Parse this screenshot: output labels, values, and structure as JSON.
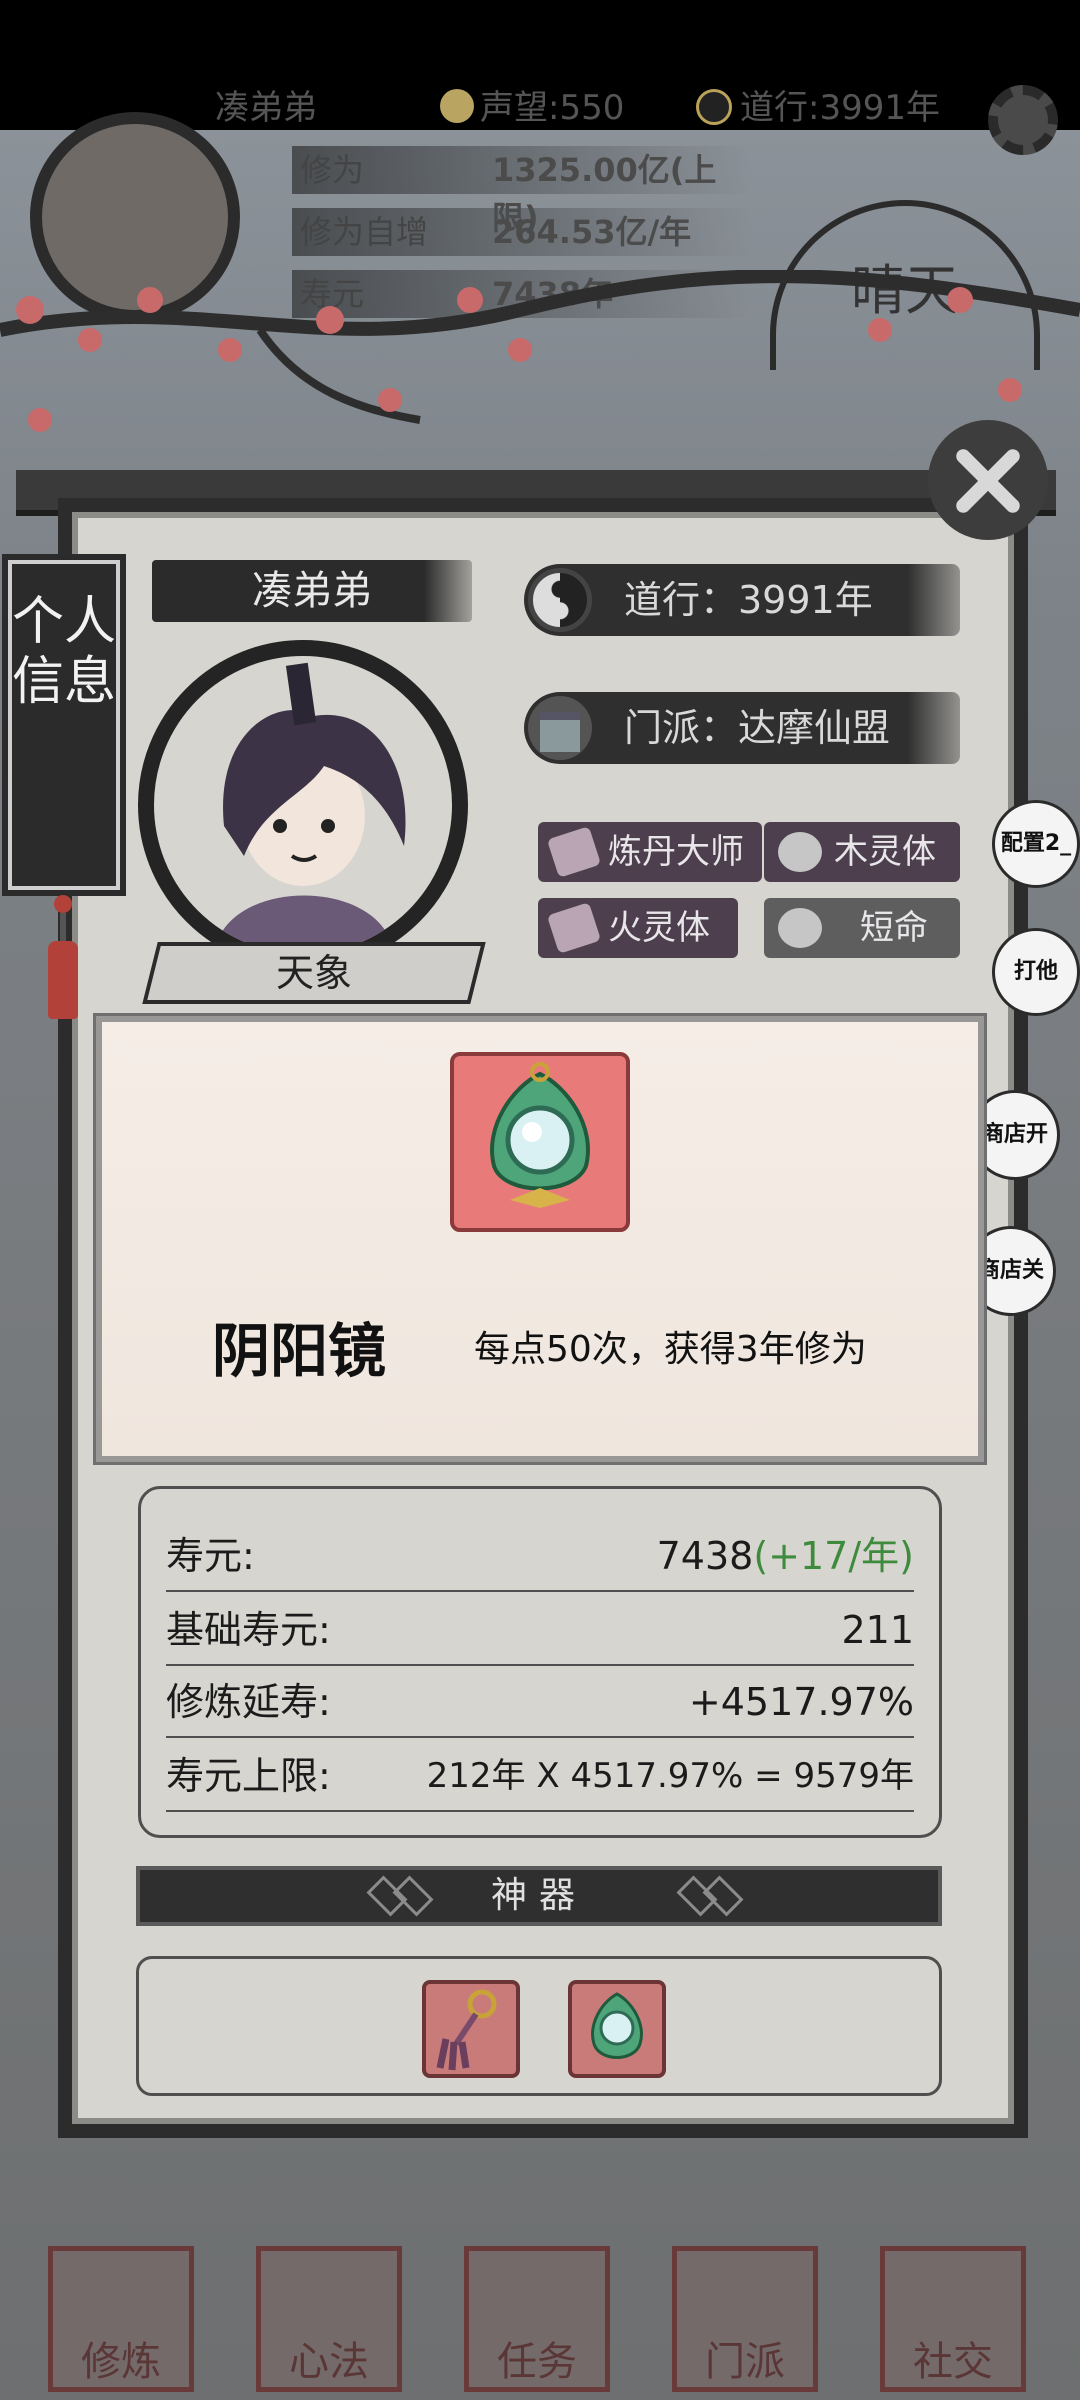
{
  "top_hud": {
    "player_name": "凑弟弟",
    "reputation_label": "声望:550",
    "daoxing_label": "道行:3991年",
    "rows": [
      {
        "label": "修为",
        "value": "1325.00亿(上限)"
      },
      {
        "label": "修为自增",
        "value": "264.53亿/年"
      },
      {
        "label": "寿元",
        "value": "7438年"
      }
    ],
    "weather": "晴天"
  },
  "side_tab": {
    "label": "个人信息"
  },
  "profile": {
    "name": "凑弟弟",
    "title": "天象",
    "daoxing": "道行：3991年",
    "sect": "门派：达摩仙盟",
    "traits": [
      {
        "label": "炼丹大师",
        "icon": "scroll-icon"
      },
      {
        "label": "木灵体",
        "icon": "fist-icon"
      },
      {
        "label": "火灵体",
        "icon": "scroll-icon"
      },
      {
        "label": "短命",
        "icon": "fist-icon"
      }
    ]
  },
  "side_buttons": [
    {
      "label": "配置2_"
    },
    {
      "label": "打他"
    },
    {
      "label": "商店开"
    },
    {
      "label": "商店关"
    }
  ],
  "popup": {
    "item_name": "阴阳镜",
    "description": "每点50次，获得3年修为",
    "item_icon": "mirror-pendant-icon"
  },
  "stats": {
    "lifespan_label": "寿元:",
    "lifespan_value": "7438",
    "lifespan_gain": "(+17/年)",
    "base_lifespan_label": "基础寿元:",
    "base_lifespan_value": "211",
    "cultivation_bonus_label": "修炼延寿:",
    "cultivation_bonus_value": "+4517.97%",
    "lifespan_cap_label": "寿元上限:",
    "lifespan_cap_value": "212年 X 4517.97% = 9579年"
  },
  "artifacts": {
    "header": "神器",
    "items": [
      {
        "icon": "tassel-charm-icon"
      },
      {
        "icon": "mirror-pendant-icon"
      }
    ]
  },
  "bottom_nav": [
    {
      "label": "修炼"
    },
    {
      "label": "心法"
    },
    {
      "label": "任务"
    },
    {
      "label": "门派"
    },
    {
      "label": "社交"
    }
  ],
  "colors": {
    "accent_green": "#3e8b3e",
    "item_bg": "#e87b7a",
    "panel_bg": "#d6d5cf",
    "dark_ink": "#2c2c2c"
  }
}
